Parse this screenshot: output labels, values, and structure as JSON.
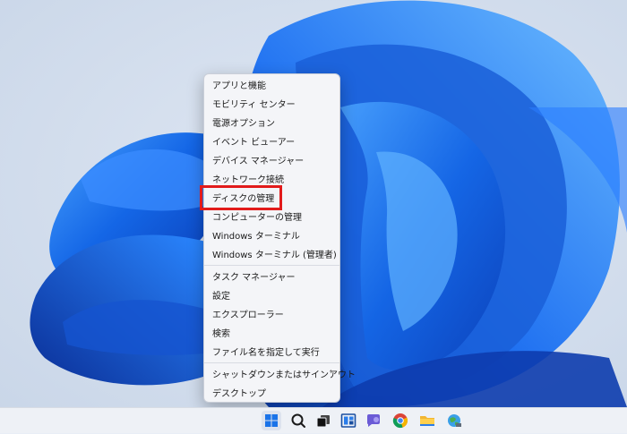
{
  "context_menu": {
    "items": [
      {
        "label": "アプリと機能"
      },
      {
        "label": "モビリティ センター"
      },
      {
        "label": "電源オプション"
      },
      {
        "label": "イベント ビューアー"
      },
      {
        "label": "デバイス マネージャー"
      },
      {
        "label": "ネットワーク接続"
      },
      {
        "label": "ディスクの管理",
        "highlighted": true
      },
      {
        "label": "コンピューターの管理"
      },
      {
        "label": "Windows ターミナル"
      },
      {
        "label": "Windows ターミナル (管理者)"
      },
      {
        "label": "タスク マネージャー"
      },
      {
        "label": "設定"
      },
      {
        "label": "エクスプローラー"
      },
      {
        "label": "検索"
      },
      {
        "label": "ファイル名を指定して実行"
      },
      {
        "label": "シャットダウンまたはサインアウト",
        "has_submenu": true
      },
      {
        "label": "デスクトップ"
      }
    ],
    "submenu_glyph": "›"
  },
  "colors": {
    "highlight_border": "#e21b1b",
    "wallpaper_accent": "#1f6fe0",
    "menu_background": "#f4f5f8"
  },
  "taskbar": {
    "icons": [
      {
        "name": "start-icon"
      },
      {
        "name": "search-icon"
      },
      {
        "name": "task-view-icon"
      },
      {
        "name": "widgets-icon"
      },
      {
        "name": "chat-icon"
      },
      {
        "name": "chrome-icon"
      },
      {
        "name": "file-explorer-icon"
      },
      {
        "name": "network-globe-icon"
      }
    ]
  }
}
